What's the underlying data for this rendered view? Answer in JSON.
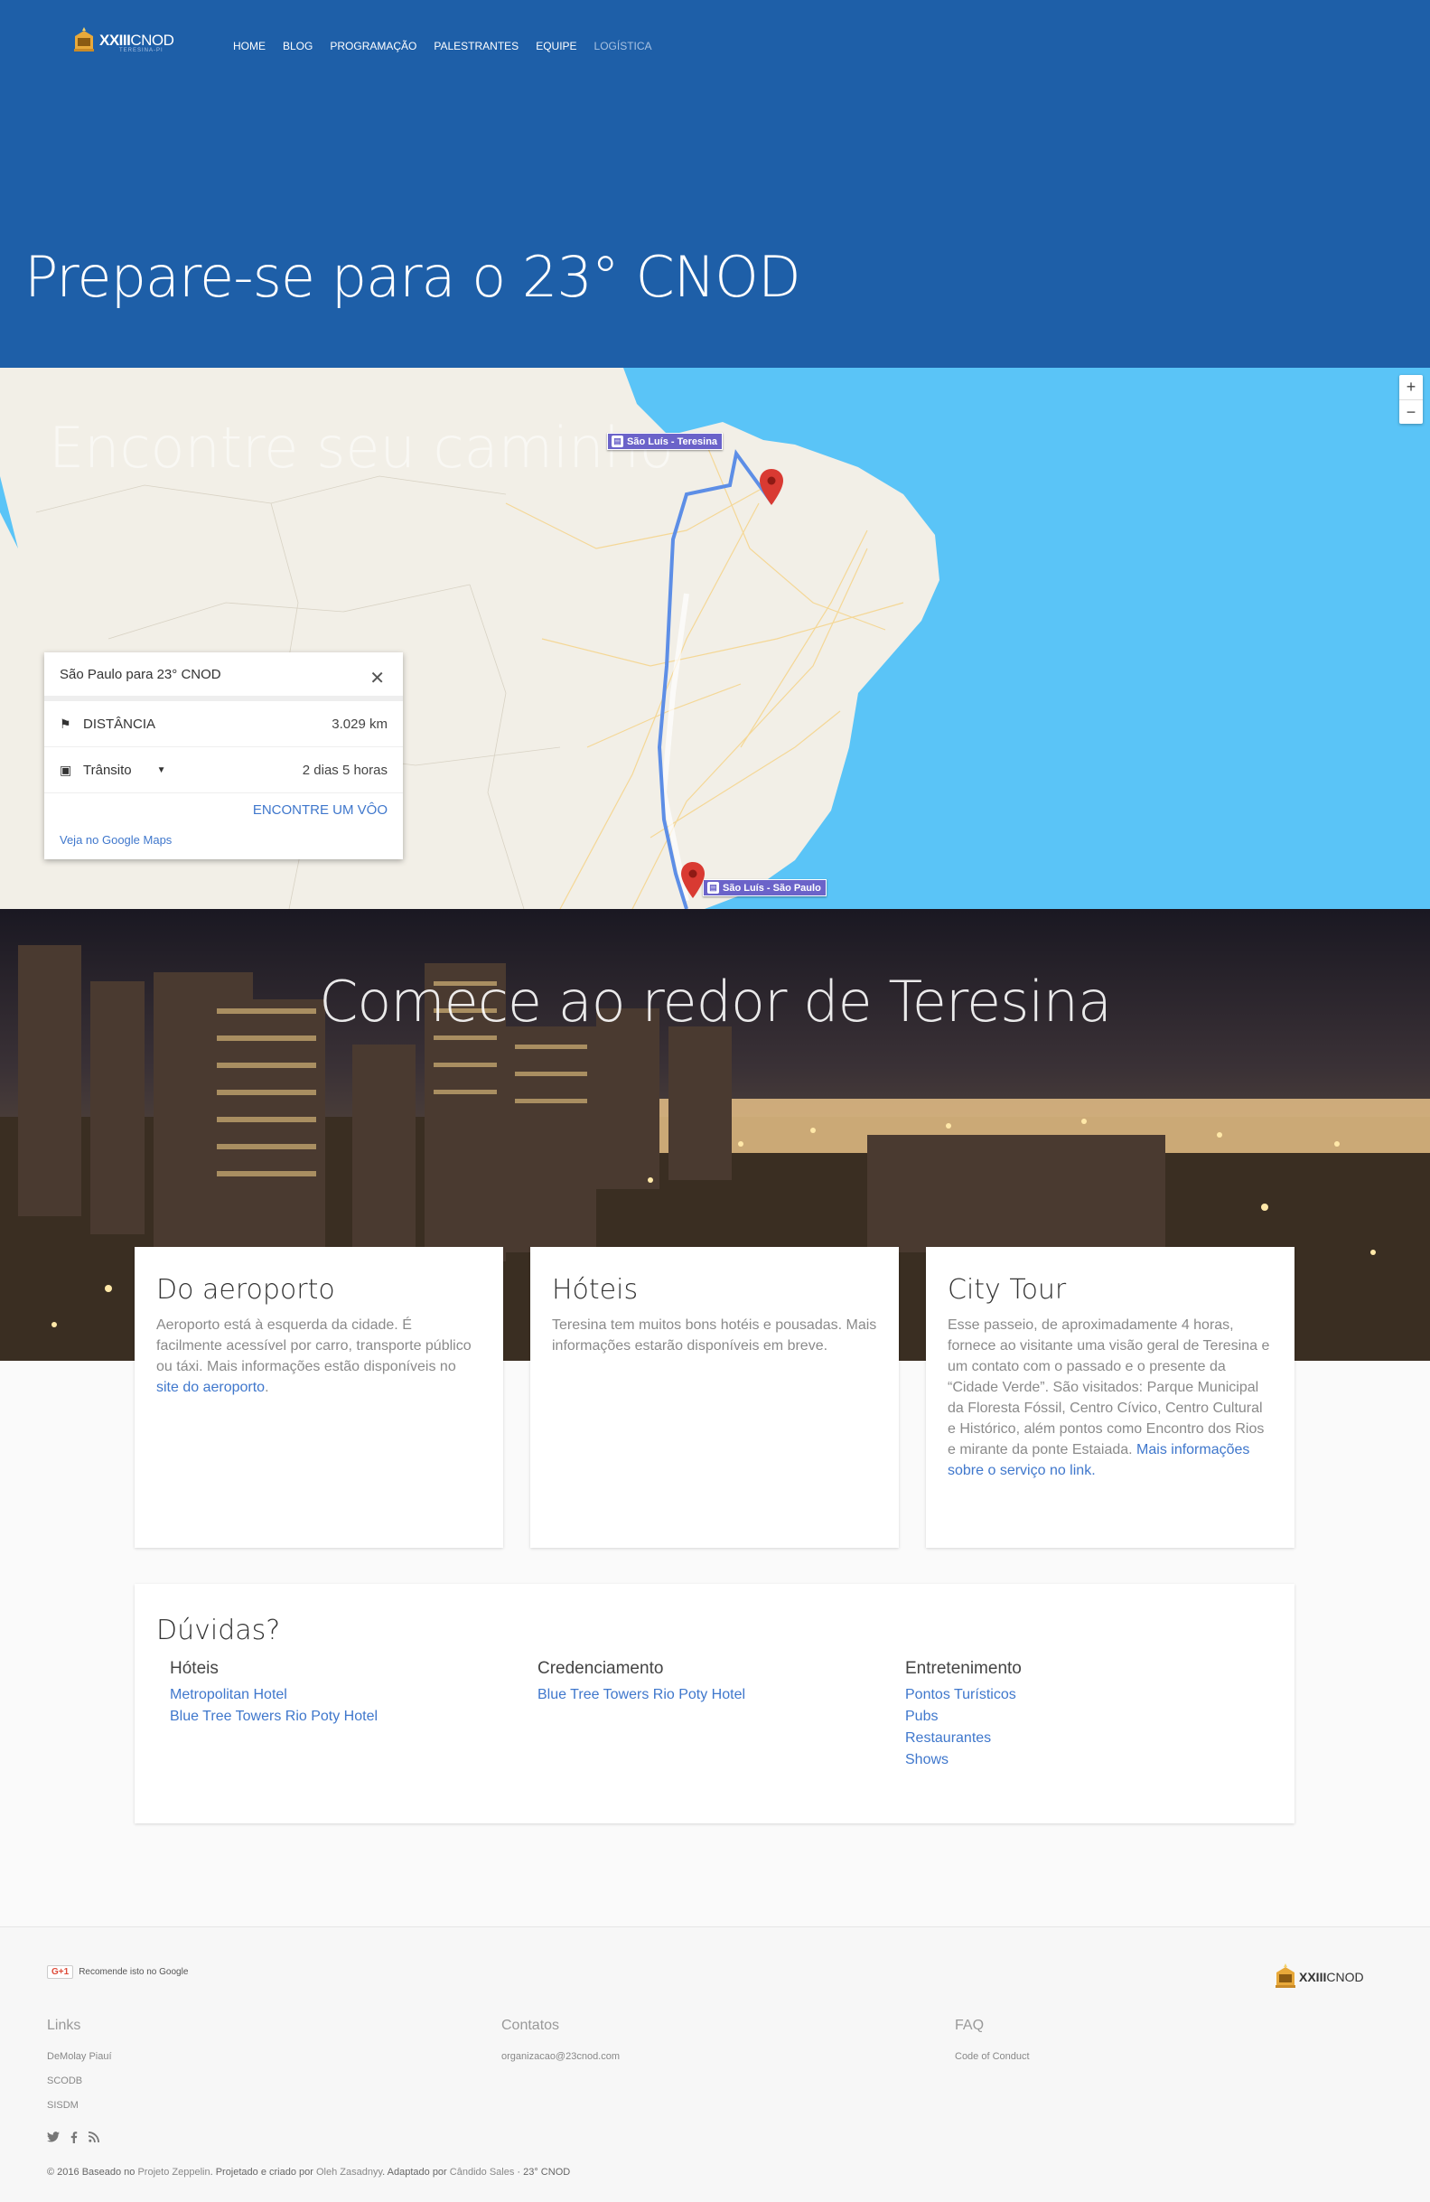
{
  "brand": {
    "logo_text_bold": "XXIII",
    "logo_text": "CNOD",
    "logo_sub": "TERESINA-PI"
  },
  "nav": [
    "HOME",
    "BLOG",
    "PROGRAMAÇÃO",
    "PALESTRANTES",
    "EQUIPE",
    "LOGÍSTICA"
  ],
  "hero": {
    "title": "Prepare-se para o 23° CNOD"
  },
  "map": {
    "overlay_title": "Encontre seu caminho",
    "zoom_in": "+",
    "zoom_out": "−",
    "tag_top": "São Luís - Teresina",
    "tag_bottom": "São Luís - São Paulo",
    "info": {
      "origin": "São Paulo",
      "connector": " para ",
      "destination": "23° CNOD",
      "close": "✕",
      "distance_label": "DISTÂNCIA",
      "distance_value": "3.029 km",
      "mode_label": "Trânsito",
      "mode_value": "2 dias 5 horas",
      "cta": "ENCONTRE UM VÔO",
      "link": "Veja no Google Maps"
    }
  },
  "city": {
    "title": "Comece ao redor de Teresina"
  },
  "cards": [
    {
      "title": "Do aeroporto",
      "text": "Aeroporto está à esquerda da cidade. É facilmente acessível por carro, transporte público ou táxi. Mais informações estão disponíveis no ",
      "link": "site do aeroporto",
      "tail": "."
    },
    {
      "title": "Hóteis",
      "text": "Teresina tem muitos bons hotéis e pousadas. Mais informações estarão disponíveis em breve.",
      "link": "",
      "tail": ""
    },
    {
      "title": "City Tour",
      "text": "Esse passeio, de aproximadamente 4 horas, fornece ao visitante uma visão geral de Teresina e um contato com o passado e o presente da “Cidade Verde”. São visitados: Parque Municipal da Floresta Fóssil, Centro Cívico, Centro Cultural e Histórico, além pontos como Encontro dos Rios e mirante da ponte Estaiada. ",
      "link": "Mais informações sobre o serviço no link.",
      "tail": ""
    }
  ],
  "faq": {
    "title": "Dúvidas?",
    "columns": [
      {
        "heading": "Hóteis",
        "links": [
          "Metropolitan Hotel",
          "Blue Tree Towers Rio Poty Hotel"
        ]
      },
      {
        "heading": "Credenciamento",
        "links": [
          "Blue Tree Towers Rio Poty Hotel"
        ]
      },
      {
        "heading": "Entretenimento",
        "links": [
          "Pontos Turísticos",
          "Pubs",
          "Restaurantes",
          "Shows"
        ]
      }
    ]
  },
  "footer": {
    "gplus_badge": "G+1",
    "gplus_text": "Recomende isto no Google",
    "logo_bold": "XXIII",
    "logo_text": "CNOD",
    "links_title": "Links",
    "links": [
      "DeMolay Piauí",
      "SCODB",
      "SISDM"
    ],
    "contacts_title": "Contatos",
    "email": "organizacao@23cnod.com",
    "faq_title": "FAQ",
    "faq_link": "Code of Conduct",
    "copyright_a": "© 2016 Baseado no ",
    "copyright_l1": "Projeto Zeppelin",
    "copyright_b": ". Projetado e criado por ",
    "copyright_l2": "Oleh Zasadnyy",
    "copyright_c": ". Adaptado por ",
    "copyright_l3": "Cândido Sales",
    "copyright_d": " · 23° CNOD"
  },
  "colors": {
    "header": "#1e5fa8",
    "ocean": "#5ac4f7",
    "link": "#3f77cc",
    "route": "#6b63c9",
    "pin": "#d93a32"
  }
}
